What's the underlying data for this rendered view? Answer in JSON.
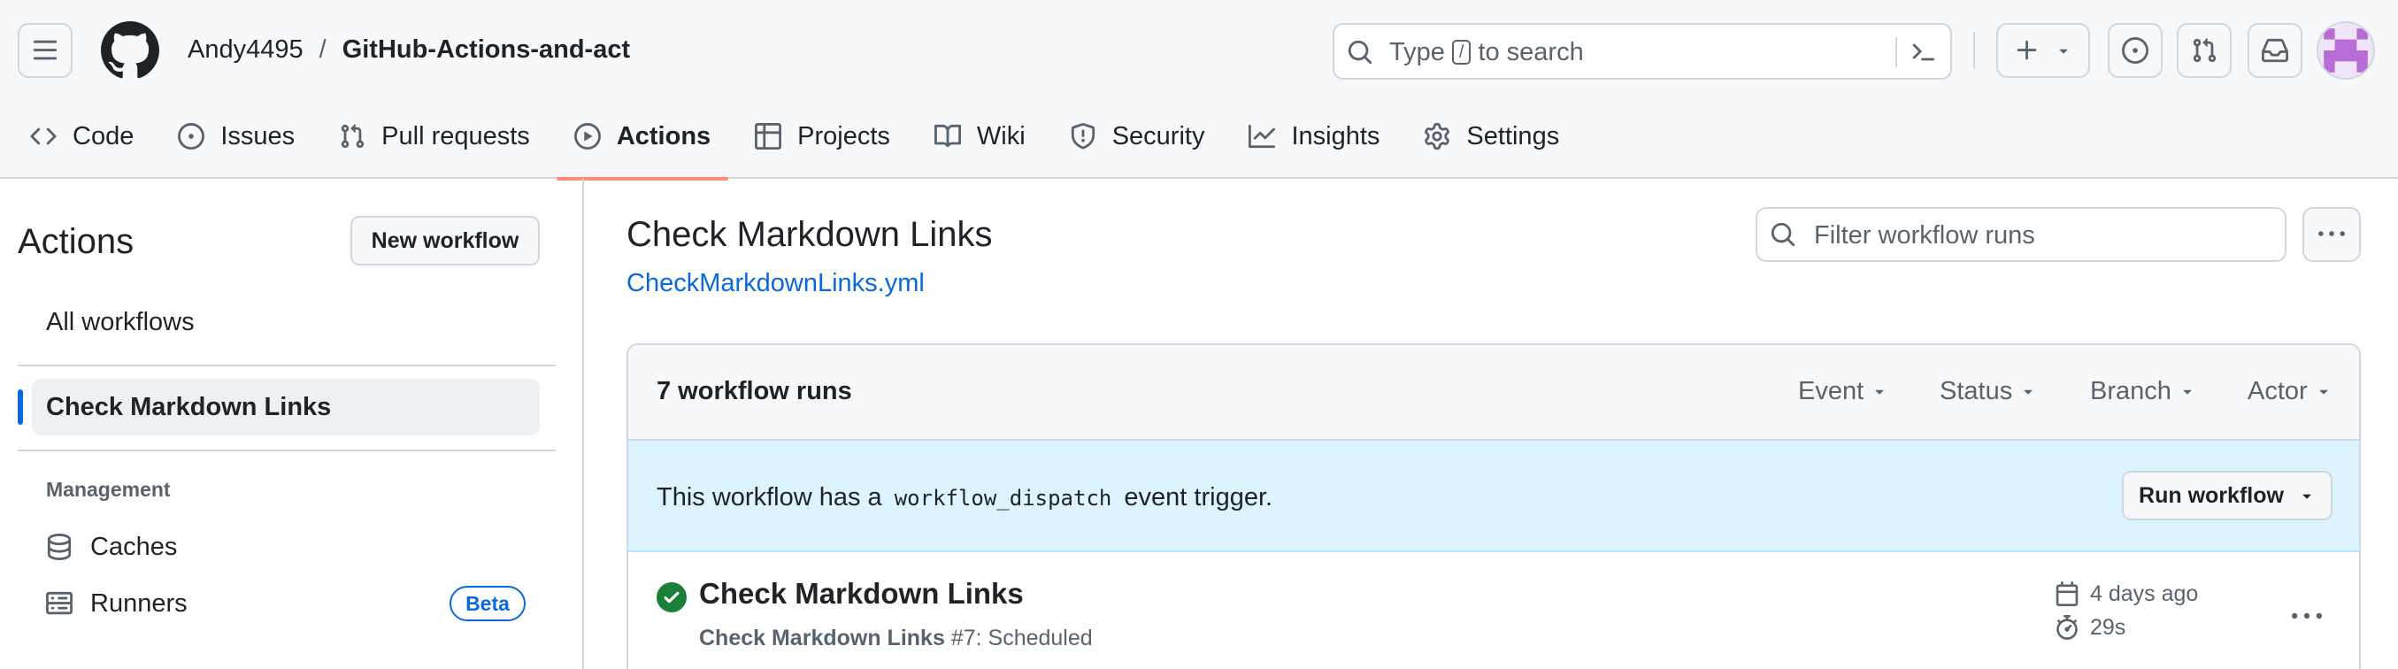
{
  "header": {
    "owner": "Andy4495",
    "separator": "/",
    "repo": "GitHub-Actions-and-act",
    "search": {
      "prefix": "Type",
      "key": "/",
      "suffix": "to search"
    }
  },
  "tabs": [
    {
      "label": "Code",
      "icon": "code-icon"
    },
    {
      "label": "Issues",
      "icon": "issue-opened-icon"
    },
    {
      "label": "Pull requests",
      "icon": "git-pull-request-icon"
    },
    {
      "label": "Actions",
      "icon": "play-icon",
      "active": true
    },
    {
      "label": "Projects",
      "icon": "table-icon"
    },
    {
      "label": "Wiki",
      "icon": "book-icon"
    },
    {
      "label": "Security",
      "icon": "shield-icon"
    },
    {
      "label": "Insights",
      "icon": "graph-icon"
    },
    {
      "label": "Settings",
      "icon": "gear-icon"
    }
  ],
  "sidebar": {
    "title": "Actions",
    "new_workflow": "New workflow",
    "all_workflows": "All workflows",
    "active_workflow": "Check Markdown Links",
    "management_label": "Management",
    "items": [
      {
        "label": "Caches",
        "icon": "database-icon"
      },
      {
        "label": "Runners",
        "icon": "server-icon",
        "badge": "Beta"
      }
    ]
  },
  "main": {
    "title": "Check Markdown Links",
    "file": "CheckMarkdownLinks.yml",
    "filter_placeholder": "Filter workflow runs",
    "runs_count": "7 workflow runs",
    "filters": [
      "Event",
      "Status",
      "Branch",
      "Actor"
    ],
    "dispatch": {
      "before": "This workflow has a",
      "code": "workflow_dispatch",
      "after": "event trigger.",
      "button": "Run workflow"
    },
    "run": {
      "title": "Check Markdown Links",
      "workflow": "Check Markdown Links",
      "number": "#7",
      "trigger": ": Scheduled",
      "date": "4 days ago",
      "duration": "29s",
      "status": "success"
    }
  },
  "colors": {
    "accent_underline": "#fd8c73",
    "link": "#0969da",
    "success": "#1a7f37",
    "dispatch_bg": "#ddf4ff"
  }
}
